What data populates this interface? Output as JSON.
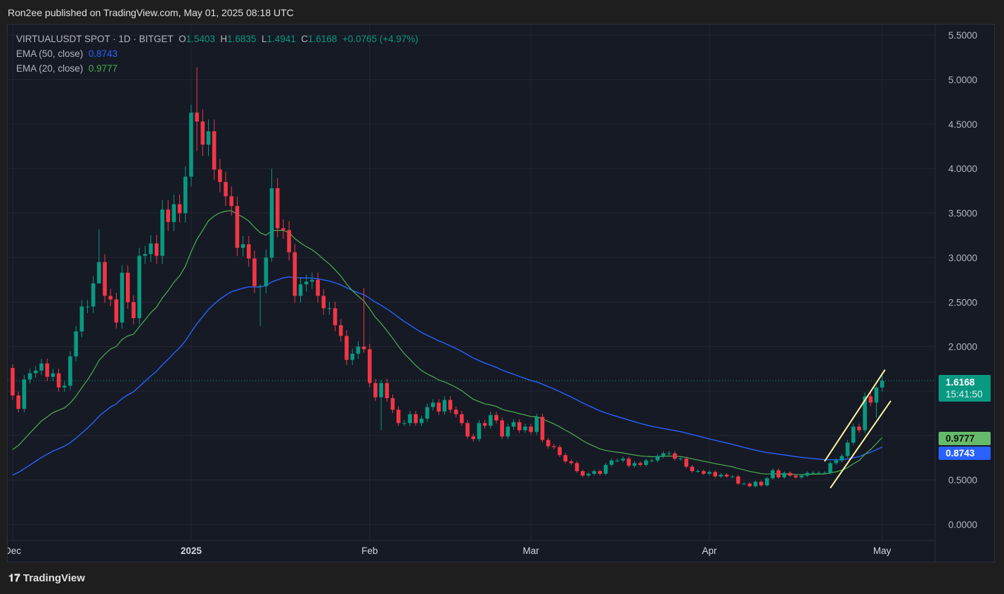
{
  "header": {
    "published": "Ron2ee published on TradingView.com, May 01, 2025 08:18 UTC"
  },
  "legend": {
    "symbol": "VIRTUALUSDT SPOT · 1D · BITGET",
    "o_label": "O",
    "o": "1.5403",
    "h_label": "H",
    "h": "1.6835",
    "l_label": "L",
    "l": "1.4941",
    "c_label": "C",
    "c": "1.6168",
    "change": "+0.0765 (+4.97%)",
    "ema50_label": "EMA (50, close)",
    "ema50": "0.8743",
    "ema20_label": "EMA (20, close)",
    "ema20": "0.9777"
  },
  "price_tag": {
    "price": "1.6168",
    "countdown": "15:41:50"
  },
  "colors": {
    "up": "#089981",
    "down": "#f23645",
    "ema20": "#4caf50",
    "ema50": "#2962ff",
    "channel": "#fff59d",
    "bg": "#161a25"
  },
  "footer": {
    "brand": "TradingView"
  },
  "chart_data": {
    "type": "candlestick",
    "title": "VIRTUALUSDT SPOT · 1D · BITGET",
    "first_open": 1.76,
    "close": [
      1.45,
      1.3,
      1.63,
      1.7,
      1.73,
      1.81,
      1.66,
      1.7,
      1.54,
      1.56,
      1.89,
      2.17,
      2.45,
      2.45,
      2.71,
      2.95,
      2.57,
      2.53,
      2.27,
      2.83,
      2.5,
      2.32,
      3.02,
      3.04,
      3.16,
      3.02,
      3.54,
      3.4,
      3.6,
      3.5,
      3.91,
      4.63,
      4.53,
      4.27,
      4.42,
      3.99,
      3.85,
      3.69,
      3.58,
      3.11,
      3.15,
      2.99,
      2.68,
      2.68,
      3.0,
      3.78,
      3.33,
      3.31,
      3.06,
      2.57,
      2.7,
      2.73,
      2.75,
      2.57,
      2.43,
      2.43,
      2.24,
      2.12,
      1.85,
      1.92,
      2.0,
      1.97,
      1.59,
      1.43,
      1.59,
      1.42,
      1.29,
      1.14,
      1.14,
      1.24,
      1.14,
      1.19,
      1.32,
      1.37,
      1.27,
      1.4,
      1.29,
      1.24,
      1.14,
      0.99,
      0.96,
      1.14,
      1.11,
      1.23,
      1.17,
      0.99,
      1.1,
      1.15,
      1.06,
      1.1,
      1.04,
      1.21,
      0.95,
      0.88,
      0.87,
      0.78,
      0.71,
      0.69,
      0.6,
      0.55,
      0.57,
      0.6,
      0.57,
      0.67,
      0.72,
      0.72,
      0.74,
      0.66,
      0.69,
      0.67,
      0.72,
      0.72,
      0.77,
      0.8,
      0.8,
      0.74,
      0.74,
      0.65,
      0.6,
      0.6,
      0.57,
      0.59,
      0.54,
      0.56,
      0.54,
      0.54,
      0.46,
      0.46,
      0.43,
      0.48,
      0.44,
      0.52,
      0.61,
      0.53,
      0.58,
      0.55,
      0.53,
      0.55,
      0.58,
      0.58,
      0.58,
      0.58,
      0.69,
      0.72,
      0.77,
      0.92,
      1.1,
      1.06,
      1.44,
      1.37,
      1.54,
      1.6168
    ],
    "notable_wicks": [
      {
        "i": 0,
        "high": 1.8,
        "low": 1.4
      },
      {
        "i": 15,
        "high": 3.32,
        "low": 2.85
      },
      {
        "i": 31,
        "high": 4.72,
        "low": 3.8
      },
      {
        "i": 32,
        "high": 5.14,
        "low": 4.2
      },
      {
        "i": 43,
        "high": 2.7,
        "low": 2.23
      },
      {
        "i": 45,
        "high": 4.0,
        "low": 2.95
      },
      {
        "i": 61,
        "high": 2.66,
        "low": 1.93
      },
      {
        "i": 64,
        "high": 1.62,
        "low": 1.06
      },
      {
        "i": 150,
        "high": 1.56,
        "low": 1.2
      },
      {
        "i": 151,
        "high": 1.6835,
        "low": 1.4941
      }
    ],
    "ema20_seed": 0.78,
    "ema50_seed": 0.52,
    "channel": [
      {
        "from": [
          141,
          0.71
        ],
        "to": [
          151.5,
          1.74
        ]
      },
      {
        "from": [
          142,
          0.41
        ],
        "to": [
          152.5,
          1.39
        ]
      }
    ],
    "x_ticks": [
      {
        "i": 0,
        "label": "Dec"
      },
      {
        "i": 31,
        "label": "2025"
      },
      {
        "i": 62,
        "label": "Feb"
      },
      {
        "i": 90,
        "label": "Mar"
      },
      {
        "i": 121,
        "label": "Apr"
      },
      {
        "i": 151,
        "label": "May"
      }
    ],
    "y_ticks": [
      "0.0000",
      "0.5000",
      "1.0000",
      "1.5000",
      "2.0000",
      "2.5000",
      "3.0000",
      "3.5000",
      "4.0000",
      "4.5000",
      "5.0000",
      "5.5000"
    ],
    "ylim": [
      0,
      5.5
    ],
    "ema20_last": 0.9777,
    "ema50_last": 0.8743
  }
}
